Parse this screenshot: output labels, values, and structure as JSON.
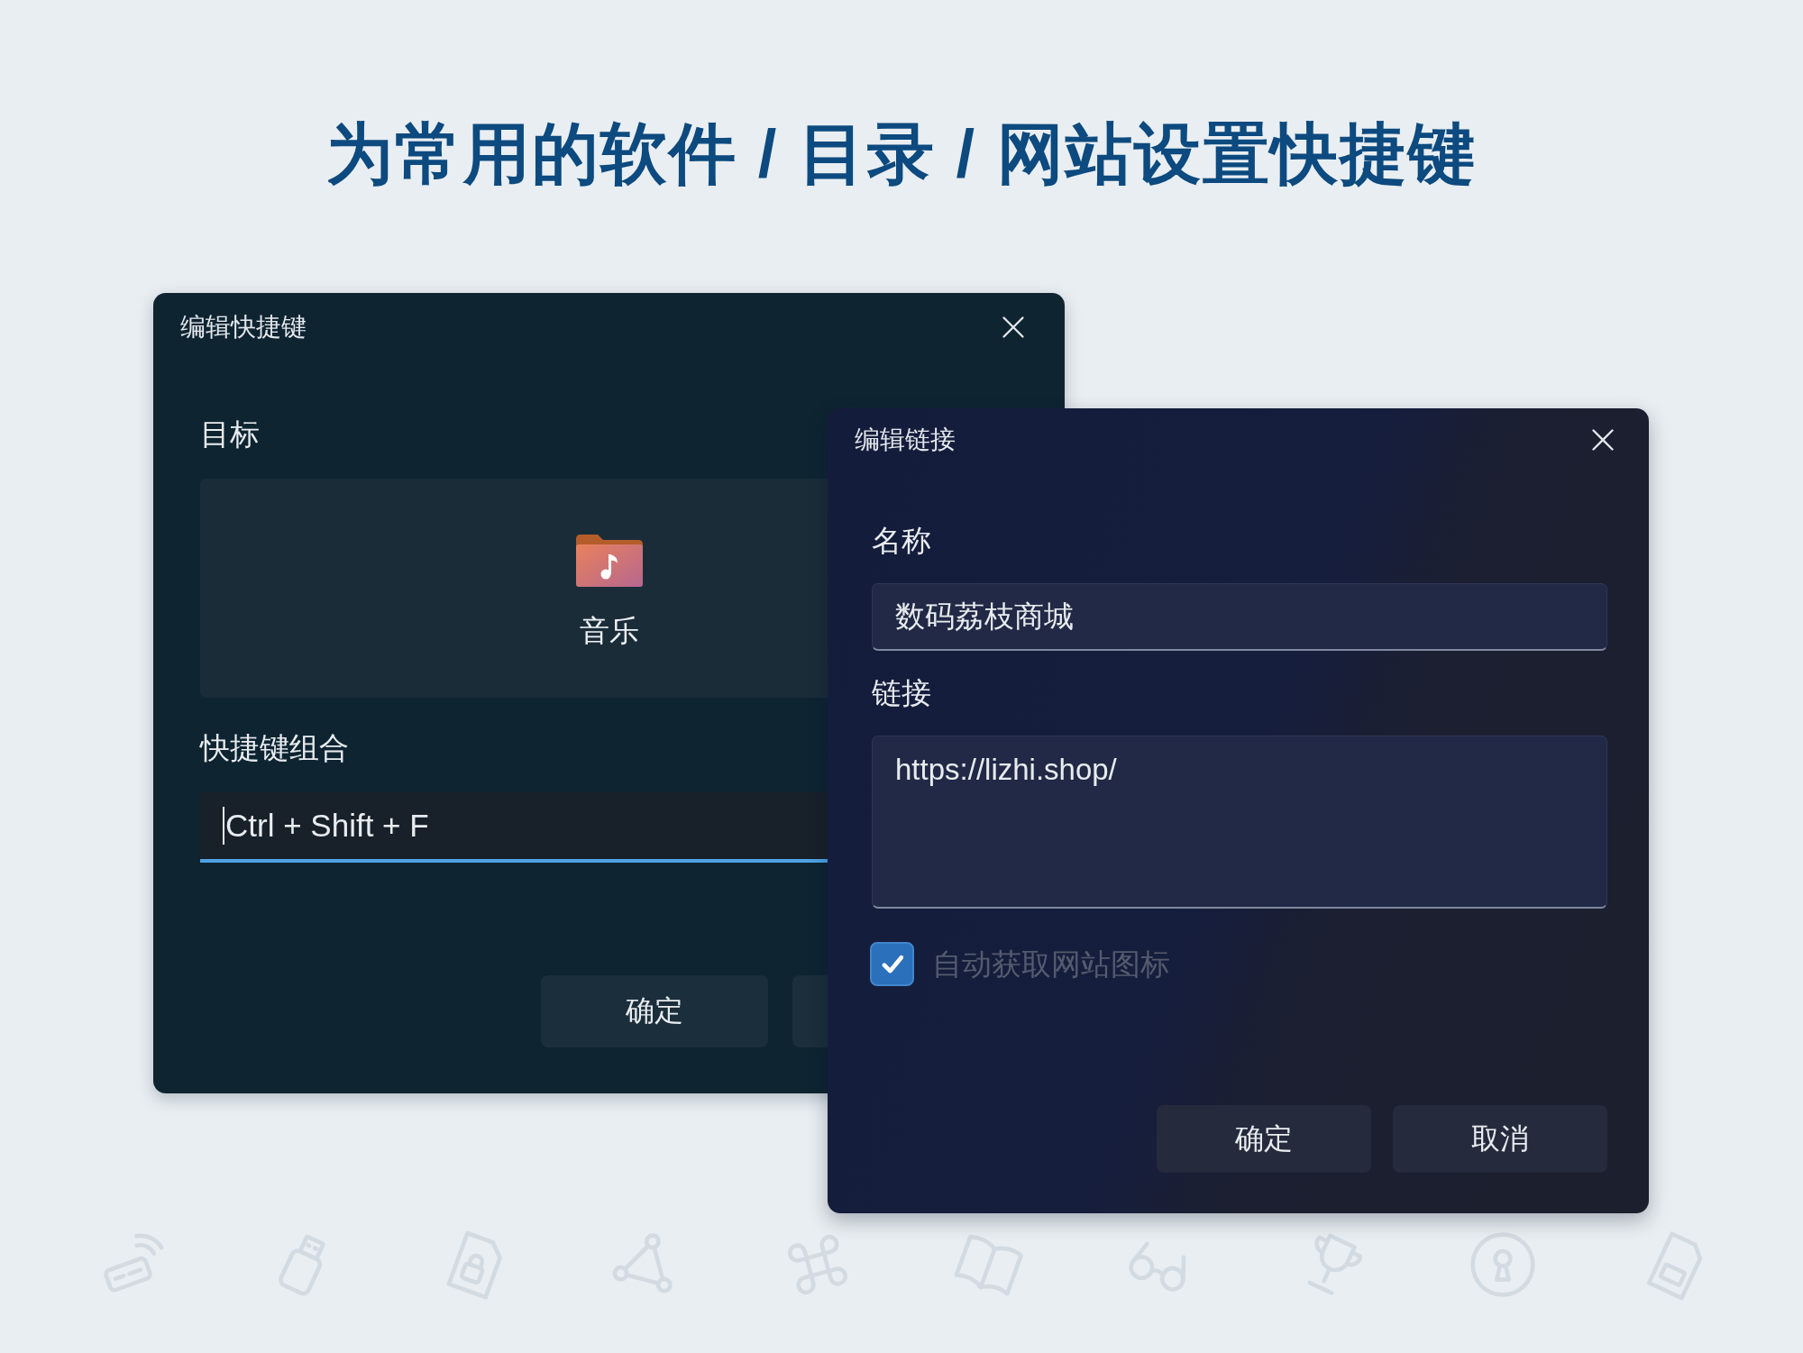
{
  "title": "为常用的软件 / 目录 / 网站设置快捷键",
  "shortcut_dialog": {
    "title": "编辑快捷键",
    "target_label": "目标",
    "target": {
      "name": "音乐"
    },
    "combo_label": "快捷键组合",
    "combo_field": {
      "value": "Ctrl + Shift + F",
      "focused": true
    },
    "buttons": [
      {
        "label": "确定"
      }
    ]
  },
  "link_dialog": {
    "title": "编辑链接",
    "name_label": "名称",
    "name_field": {
      "value": "数码荔枝商城"
    },
    "link_label": "链接",
    "link_field": {
      "value": "https://lizhi.shop/"
    },
    "auto_icon": {
      "label": "自动获取网站图标",
      "checked": true
    },
    "buttons": [
      {
        "label": "确定"
      },
      {
        "label": "取消"
      }
    ]
  }
}
